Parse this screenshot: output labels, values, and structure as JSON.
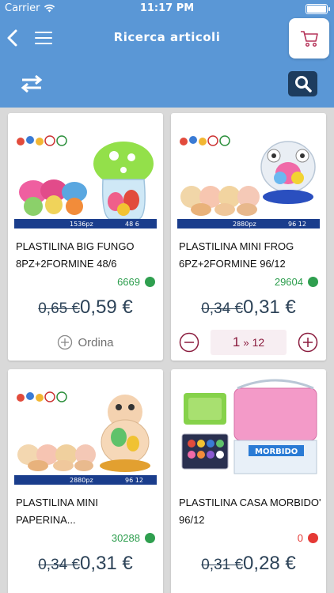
{
  "status_bar": {
    "carrier": "Carrier",
    "time": "11:17 PM"
  },
  "header": {
    "title": "Ricerca articoli"
  },
  "icons": [
    "back-icon",
    "menu-icon",
    "cart-icon",
    "swap-icon",
    "search-icon",
    "plus-circle-icon",
    "minus-circle-icon"
  ],
  "colors": {
    "header": "#5a97d6",
    "search": "#1d3c5e",
    "cart": "#b5345a",
    "stock_ok": "#2f9f4f",
    "stock_out": "#e53935"
  },
  "products": [
    {
      "title": "PLASTILINA BIG FUNGO 8PZ+2FORMINE 48/6",
      "stock": "6669",
      "stock_status": "green",
      "old_price": "0,65 €",
      "new_price": "0,59 €",
      "order_label": "Ordina",
      "image": {
        "pack_text": "1536pz",
        "pack_info": "48 6"
      }
    },
    {
      "title": "PLASTILINA MINI FROG 6PZ+2FORMINE 96/12",
      "stock": "29604",
      "stock_status": "green",
      "old_price": "0,34 €",
      "new_price": "0,31 €",
      "qty": "1",
      "qty_sep": "»",
      "qty_multiple": "12",
      "image": {
        "pack_text": "2880pz",
        "pack_info": "96 12"
      }
    },
    {
      "title": "PLASTILINA MINI PAPERINA...",
      "stock": "30288",
      "stock_status": "green",
      "old_price": "0,34 €",
      "new_price": "0,31 €",
      "image": {
        "pack_text": "2880pz",
        "pack_info": "96 12"
      }
    },
    {
      "title": "PLASTILINA CASA MORBIDO' 96/12",
      "stock": "0",
      "stock_status": "red",
      "old_price": "0,31 €",
      "new_price": "0,28 €",
      "image": {
        "brand": "MORBIDO"
      }
    }
  ]
}
